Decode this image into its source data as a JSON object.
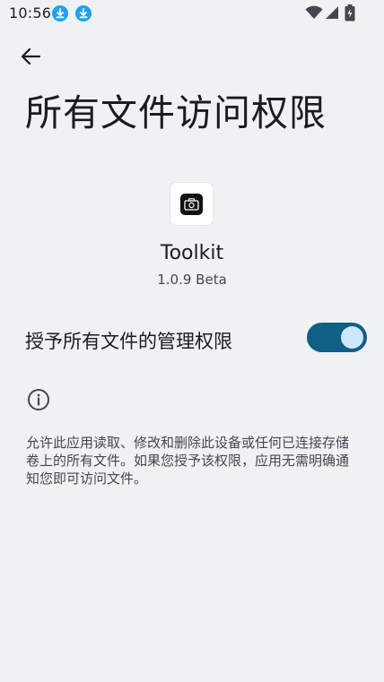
{
  "status_bar": {
    "time": "10:56"
  },
  "header": {
    "title": "所有文件访问权限"
  },
  "app": {
    "name": "Toolkit",
    "version": "1.0.9 Beta"
  },
  "permission": {
    "label": "授予所有文件的管理权限",
    "enabled": true
  },
  "info": {
    "description": "允许此应用读取、修改和删除此设备或任何已连接存储卷上的所有文件。如果您授予该权限，应用无需明确通知您即可访问文件。"
  },
  "colors": {
    "background": "#f0f1f3",
    "switch_track": "#0f5f86",
    "switch_thumb": "#cfe6ff",
    "download_badge": "#1aa3f0"
  }
}
